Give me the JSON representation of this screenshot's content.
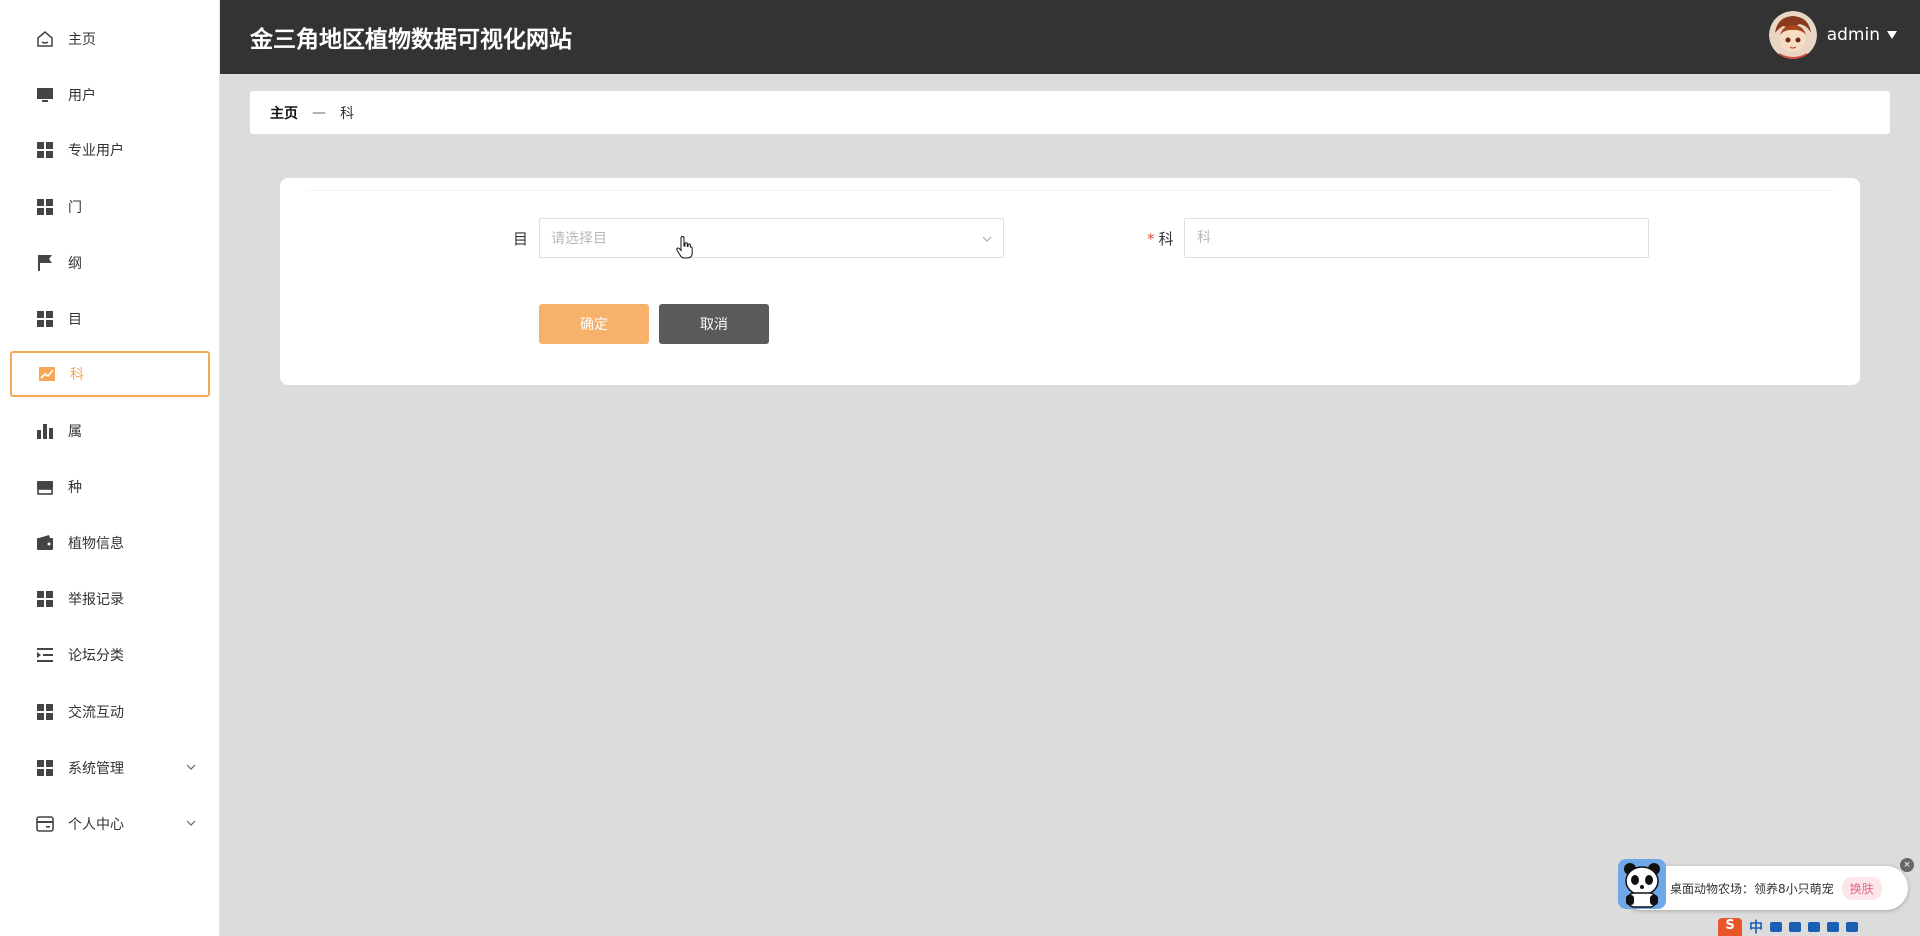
{
  "header": {
    "title": "金三角地区植物数据可视化网站",
    "username": "admin"
  },
  "sidebar": {
    "items": [
      {
        "label": "主页",
        "icon": "home-icon"
      },
      {
        "label": "用户",
        "icon": "monitor-icon"
      },
      {
        "label": "专业用户",
        "icon": "grid-icon"
      },
      {
        "label": "门",
        "icon": "grid-icon"
      },
      {
        "label": "纲",
        "icon": "flag-icon"
      },
      {
        "label": "目",
        "icon": "grid-icon"
      },
      {
        "label": "科",
        "icon": "chart-icon"
      },
      {
        "label": "属",
        "icon": "bar-chart-icon"
      },
      {
        "label": "种",
        "icon": "store-icon"
      },
      {
        "label": "植物信息",
        "icon": "wallet-icon"
      },
      {
        "label": "举报记录",
        "icon": "grid-icon"
      },
      {
        "label": "论坛分类",
        "icon": "indent-icon"
      },
      {
        "label": "交流互动",
        "icon": "grid-icon"
      },
      {
        "label": "系统管理",
        "icon": "grid-icon"
      },
      {
        "label": "个人中心",
        "icon": "card-icon"
      }
    ],
    "active_index": 6
  },
  "breadcrumb": {
    "home": "主页",
    "separator": "—",
    "current": "科"
  },
  "form": {
    "order_label": "目",
    "order_placeholder": "请选择目",
    "family_required_mark": "*",
    "family_label": "科",
    "family_placeholder": "科",
    "family_value": "",
    "confirm_label": "确定",
    "cancel_label": "取消"
  },
  "ad": {
    "text": "桌面动物农场：领养8小只萌宠",
    "button": "换肤",
    "close": "×"
  },
  "ime": {
    "logo": "S",
    "mode": "中"
  },
  "colors": {
    "accent": "#f6a858",
    "header_bg": "#333333",
    "confirm_btn": "#f6b16a",
    "cancel_btn": "#5a5a5a",
    "page_bg": "#dcdcdc"
  }
}
